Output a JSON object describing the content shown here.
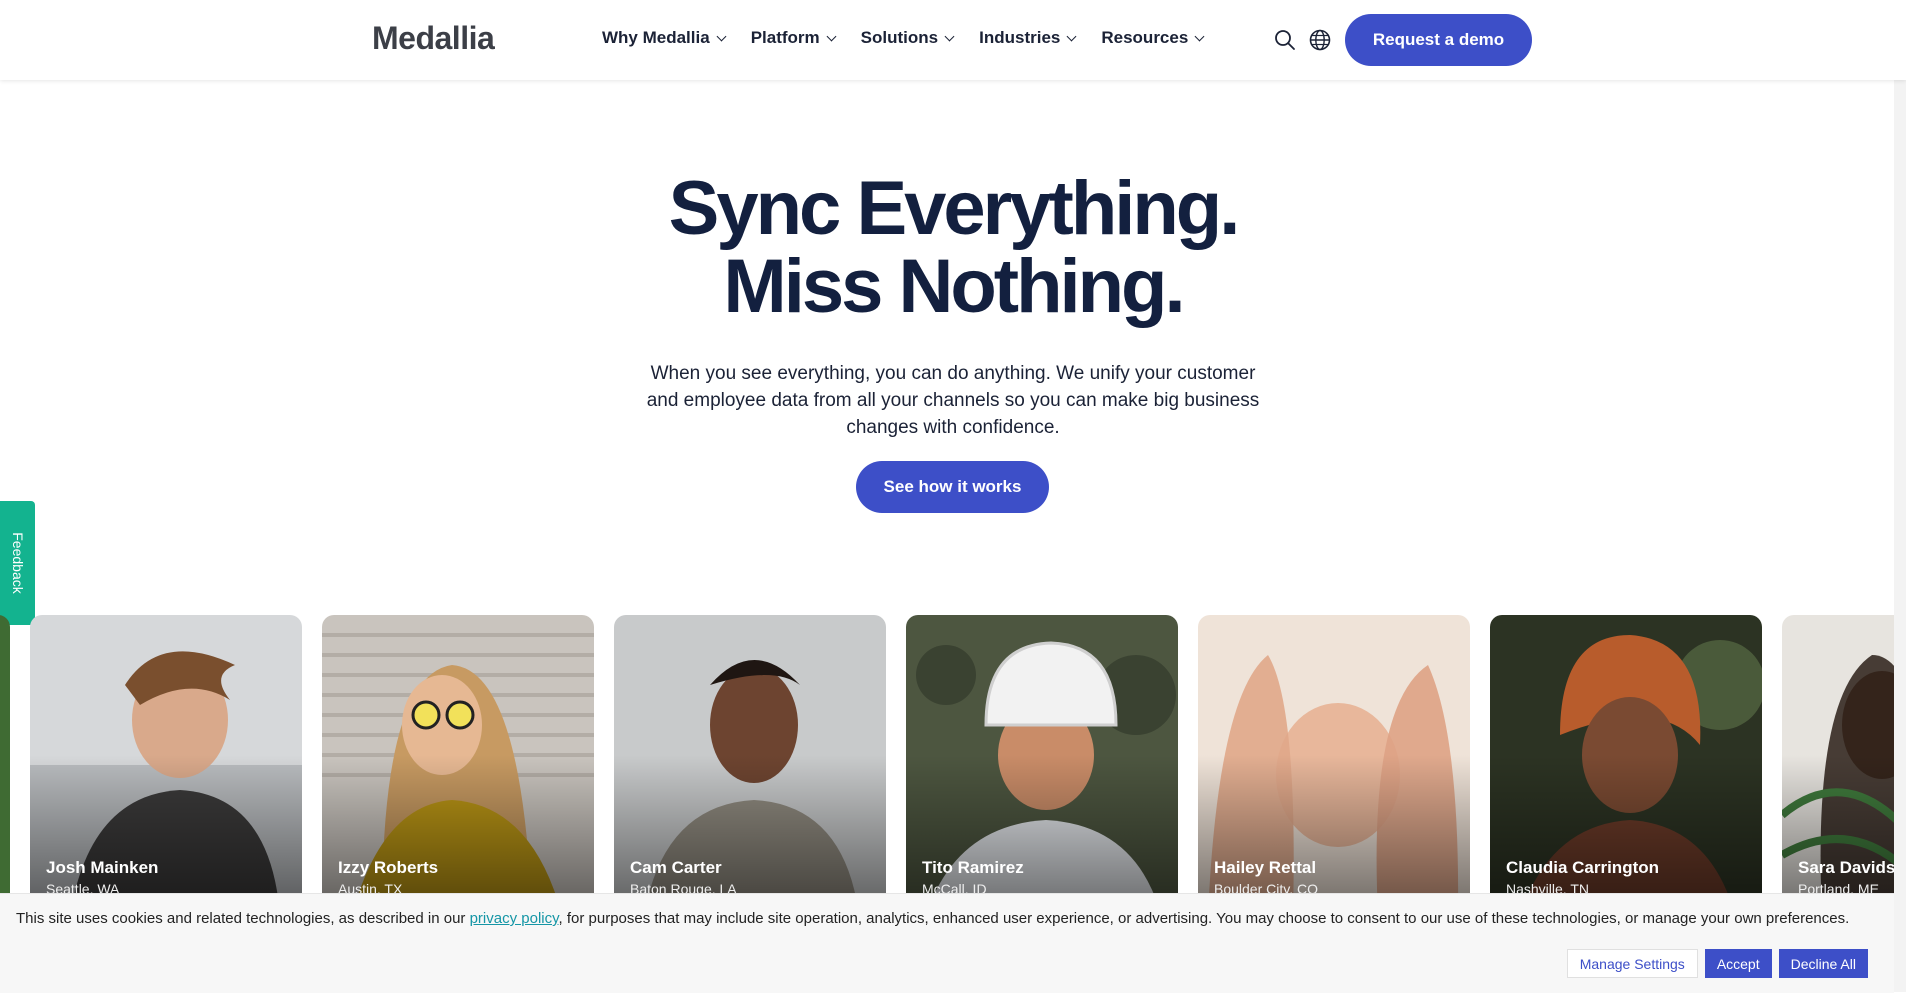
{
  "brand": {
    "logo_text": "Medallia",
    "accent": "#3d4fc8",
    "heading_color": "#13203f"
  },
  "nav": {
    "items": [
      {
        "label": "Why Medallia"
      },
      {
        "label": "Platform"
      },
      {
        "label": "Solutions"
      },
      {
        "label": "Industries"
      },
      {
        "label": "Resources"
      }
    ],
    "icons": [
      "search-icon",
      "globe-icon"
    ],
    "cta_label": "Request a demo"
  },
  "hero": {
    "title_line1": "Sync Everything.",
    "title_line2": "Miss Nothing.",
    "subtitle": "When you see everything, you can do anything. We unify your customer and employee data from all your channels so you can make big business changes with confidence.",
    "cta_label": "See how it works"
  },
  "feedback_tab": {
    "label": "Feedback",
    "color": "#13b38f"
  },
  "people": [
    {
      "name": "Josh Mainken",
      "location": "Seattle, WA"
    },
    {
      "name": "Izzy Roberts",
      "location": "Austin, TX"
    },
    {
      "name": "Cam Carter",
      "location": "Baton Rouge, LA"
    },
    {
      "name": "Tito Ramirez",
      "location": "McCall, ID"
    },
    {
      "name": "Hailey Rettal",
      "location": "Boulder City, CO"
    },
    {
      "name": "Claudia Carrington",
      "location": "Nashville, TN"
    },
    {
      "name": "Sara Davidson",
      "location": "Portland, ME"
    }
  ],
  "cookie": {
    "text_before": "This site uses cookies and related technologies, as described in our ",
    "link_text": "privacy policy",
    "text_after": ", for purposes that may include site operation, analytics, enhanced user experience, or advertising. You may choose to consent to our use of these technologies, or manage your own preferences.",
    "manage_label": "Manage Settings",
    "accept_label": "Accept",
    "decline_label": "Decline All"
  }
}
